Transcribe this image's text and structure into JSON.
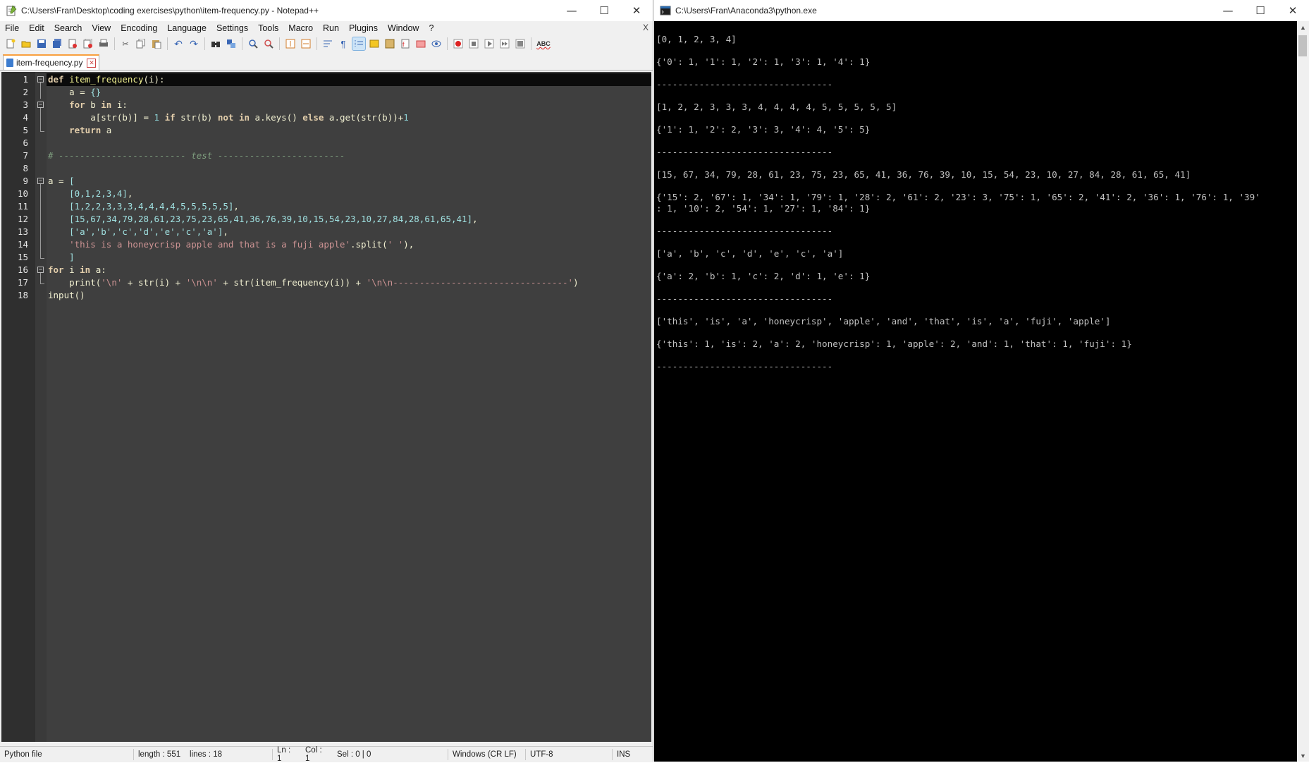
{
  "npp": {
    "title": "C:\\Users\\Fran\\Desktop\\coding exercises\\python\\item-frequency.py - Notepad++",
    "menus": [
      "File",
      "Edit",
      "Search",
      "View",
      "Encoding",
      "Language",
      "Settings",
      "Tools",
      "Macro",
      "Run",
      "Plugins",
      "Window",
      "?"
    ],
    "menu_close": "X",
    "tab_label": "item-frequency.py",
    "line_numbers": [
      "1",
      "2",
      "3",
      "4",
      "5",
      "6",
      "7",
      "8",
      "9",
      "10",
      "11",
      "12",
      "13",
      "14",
      "15",
      "16",
      "17",
      "18"
    ],
    "status": {
      "filetype": "Python file",
      "length": "length : 551",
      "lines": "lines : 18",
      "ln": "Ln : 1",
      "col": "Col : 1",
      "sel": "Sel : 0 | 0",
      "eol": "Windows (CR LF)",
      "encoding": "UTF-8",
      "mode": "INS"
    }
  },
  "code": [
    [
      [
        "kw",
        "def"
      ],
      [
        "op",
        " "
      ],
      [
        "fn",
        "item_frequency"
      ],
      [
        "op",
        "(i):"
      ]
    ],
    [
      [
        "op",
        "    a = "
      ],
      [
        "br",
        "{}"
      ]
    ],
    [
      [
        "op",
        "    "
      ],
      [
        "kw",
        "for"
      ],
      [
        "op",
        " b "
      ],
      [
        "kw",
        "in"
      ],
      [
        "op",
        " i:"
      ]
    ],
    [
      [
        "op",
        "        a[str(b)] = "
      ],
      [
        "num",
        "1"
      ],
      [
        "op",
        " "
      ],
      [
        "kw",
        "if"
      ],
      [
        "op",
        " str(b) "
      ],
      [
        "kw",
        "not in"
      ],
      [
        "op",
        " a.keys() "
      ],
      [
        "kw",
        "else"
      ],
      [
        "op",
        " a.get(str(b))+"
      ],
      [
        "num",
        "1"
      ]
    ],
    [
      [
        "op",
        "    "
      ],
      [
        "kw",
        "return"
      ],
      [
        "op",
        " a"
      ]
    ],
    [],
    [
      [
        "cmt",
        "# ------------------------ test ------------------------"
      ]
    ],
    [],
    [
      [
        "op",
        "a = "
      ],
      [
        "br",
        "["
      ]
    ],
    [
      [
        "op",
        "    "
      ],
      [
        "br",
        "[0,1,2,3,4]"
      ],
      [
        "op",
        ","
      ]
    ],
    [
      [
        "op",
        "    "
      ],
      [
        "br",
        "[1,2,2,3,3,3,4,4,4,4,5,5,5,5,5]"
      ],
      [
        "op",
        ","
      ]
    ],
    [
      [
        "op",
        "    "
      ],
      [
        "br",
        "[15,67,34,79,28,61,23,75,23,65,41,36,76,39,10,15,54,23,10,27,84,28,61,65,41]"
      ],
      [
        "op",
        ","
      ]
    ],
    [
      [
        "op",
        "    "
      ],
      [
        "br",
        "['a','b','c','d','e','c','a']"
      ],
      [
        "op",
        ","
      ]
    ],
    [
      [
        "op",
        "    "
      ],
      [
        "str",
        "'this is a honeycrisp apple and that is a fuji apple'"
      ],
      [
        "op",
        ".split("
      ],
      [
        "str",
        "' '"
      ],
      [
        "op",
        "),"
      ]
    ],
    [
      [
        "op",
        "    "
      ],
      [
        "br",
        "]"
      ]
    ],
    [
      [
        "kw",
        "for"
      ],
      [
        "op",
        " i "
      ],
      [
        "kw",
        "in"
      ],
      [
        "op",
        " a:"
      ]
    ],
    [
      [
        "op",
        "    print("
      ],
      [
        "str",
        "'\\n'"
      ],
      [
        "op",
        " + str(i) + "
      ],
      [
        "str",
        "'\\n\\n'"
      ],
      [
        "op",
        " + str(item_frequency(i)) + "
      ],
      [
        "str",
        "'\\n\\n---------------------------------'"
      ],
      [
        "op",
        ")"
      ]
    ],
    [
      [
        "op",
        "input()"
      ]
    ]
  ],
  "console": {
    "title": "C:\\Users\\Fran\\Anaconda3\\python.exe",
    "lines": [
      "[0, 1, 2, 3, 4]",
      "",
      "{'0': 1, '1': 1, '2': 1, '3': 1, '4': 1}",
      "",
      "---------------------------------",
      "",
      "[1, 2, 2, 3, 3, 3, 4, 4, 4, 4, 5, 5, 5, 5, 5]",
      "",
      "{'1': 1, '2': 2, '3': 3, '4': 4, '5': 5}",
      "",
      "---------------------------------",
      "",
      "[15, 67, 34, 79, 28, 61, 23, 75, 23, 65, 41, 36, 76, 39, 10, 15, 54, 23, 10, 27, 84, 28, 61, 65, 41]",
      "",
      "{'15': 2, '67': 1, '34': 1, '79': 1, '28': 2, '61': 2, '23': 3, '75': 1, '65': 2, '41': 2, '36': 1, '76': 1, '39'",
      ": 1, '10': 2, '54': 1, '27': 1, '84': 1}",
      "",
      "---------------------------------",
      "",
      "['a', 'b', 'c', 'd', 'e', 'c', 'a']",
      "",
      "{'a': 2, 'b': 1, 'c': 2, 'd': 1, 'e': 1}",
      "",
      "---------------------------------",
      "",
      "['this', 'is', 'a', 'honeycrisp', 'apple', 'and', 'that', 'is', 'a', 'fuji', 'apple']",
      "",
      "{'this': 1, 'is': 2, 'a': 2, 'honeycrisp': 1, 'apple': 2, 'and': 1, 'that': 1, 'fuji': 1}",
      "",
      "---------------------------------"
    ]
  },
  "colors": {
    "editor_bg": "#3f3f3f",
    "current_line": "#0b0b0b",
    "keyword": "#e3ceab",
    "string": "#cc9393",
    "bracket": "#9fe0e0",
    "comment": "#7f9f7f",
    "console_bg": "#000000",
    "console_fg": "#c0c0c0"
  }
}
